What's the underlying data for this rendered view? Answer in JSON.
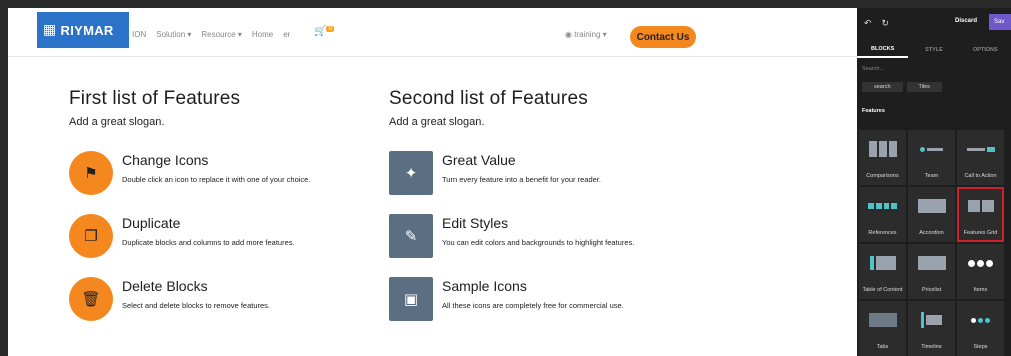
{
  "topnav": {
    "logo": "RIYMAR",
    "links": [
      "ION",
      "Solution ▾",
      "Resource ▾",
      "Home",
      "er"
    ],
    "cart_badge": "0",
    "user": "training ▾",
    "contact": "Contact Us"
  },
  "col1": {
    "title": "First list of Features",
    "slogan": "Add a great slogan.",
    "features": [
      {
        "title": "Change Icons",
        "desc": "Double click an icon to replace it with one of your choice."
      },
      {
        "title": "Duplicate",
        "desc": "Duplicate blocks and columns to add more features."
      },
      {
        "title": "Delete Blocks",
        "desc": "Select and delete blocks to remove features."
      }
    ]
  },
  "col2": {
    "title": "Second list of Features",
    "slogan": "Add a great slogan.",
    "features": [
      {
        "title": "Great Value",
        "desc": "Turn every feature into a benefit for your reader."
      },
      {
        "title": "Edit Styles",
        "desc": "You can edit colors and backgrounds to highlight features."
      },
      {
        "title": "Sample Icons",
        "desc": "All these icons are completely free for commercial use."
      }
    ]
  },
  "panel": {
    "discard": "Discard",
    "save": "Sav",
    "tabs": [
      "BLOCKS",
      "STYLE",
      "OPTIONS"
    ],
    "search_placeholder": "Search...",
    "filters": [
      "search",
      "Tiles"
    ],
    "section": "Features",
    "tiles": [
      "Comparisons",
      "Team",
      "Call to Action",
      "References",
      "Accordion",
      "Features Grid",
      "Table of Content",
      "Pricelist",
      "Items",
      "Tabs",
      "Timeline",
      "Steps"
    ]
  },
  "colors": {
    "accent": "#f5871f",
    "icon_square": "#5c6e82",
    "selection": "#d0202a",
    "save": "#6f58c9"
  }
}
